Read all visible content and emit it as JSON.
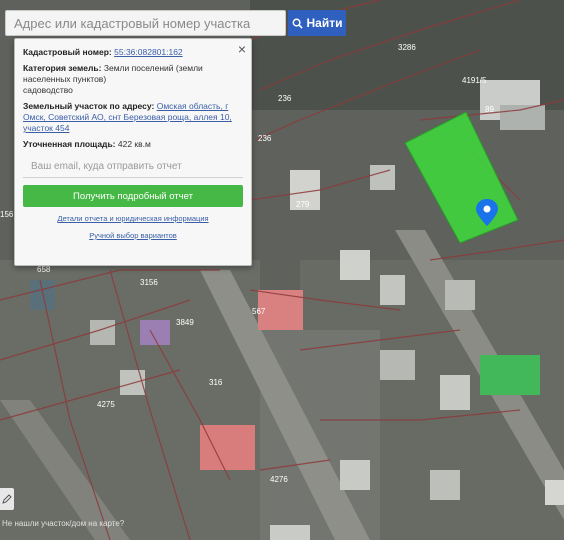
{
  "search": {
    "placeholder": "Адрес или кадастровый номер участка",
    "button_label": "Найти"
  },
  "popup": {
    "cadastral_label": "Кадастровый номер:",
    "cadastral_value": "55:36:082801:162",
    "category_label": "Категория земель:",
    "category_value": "Земли поселений (земли населенных пунктов)",
    "category_extra": "садоводство",
    "address_label": "Земельный участок по адресу:",
    "address_value": "Омская область, г Омск, Советский АО, снт Березовая роща, аллея 10, участок 454",
    "area_label": "Уточненная площадь:",
    "area_value": "422 кв.м",
    "email_placeholder": "Ваш email, куда отправить отчет",
    "report_button": "Получить подробный отчет",
    "details_link": "Детали отчета и юридическая информация",
    "variants_link": "Ручной выбор вариантов",
    "close_symbol": "×"
  },
  "map": {
    "labels": [
      "3286",
      "4191/5",
      "89",
      "236",
      "236",
      "279",
      "156",
      "658",
      "3156",
      "567",
      "3849",
      "4275",
      "316",
      "4276"
    ],
    "marker_color": "#1a73e8",
    "parcel_color": "#3ddc3a"
  },
  "bottom_text": "Не нашли участок/дом на карте?",
  "colors": {
    "accent": "#2f5fbf",
    "report_button": "#45b845"
  }
}
